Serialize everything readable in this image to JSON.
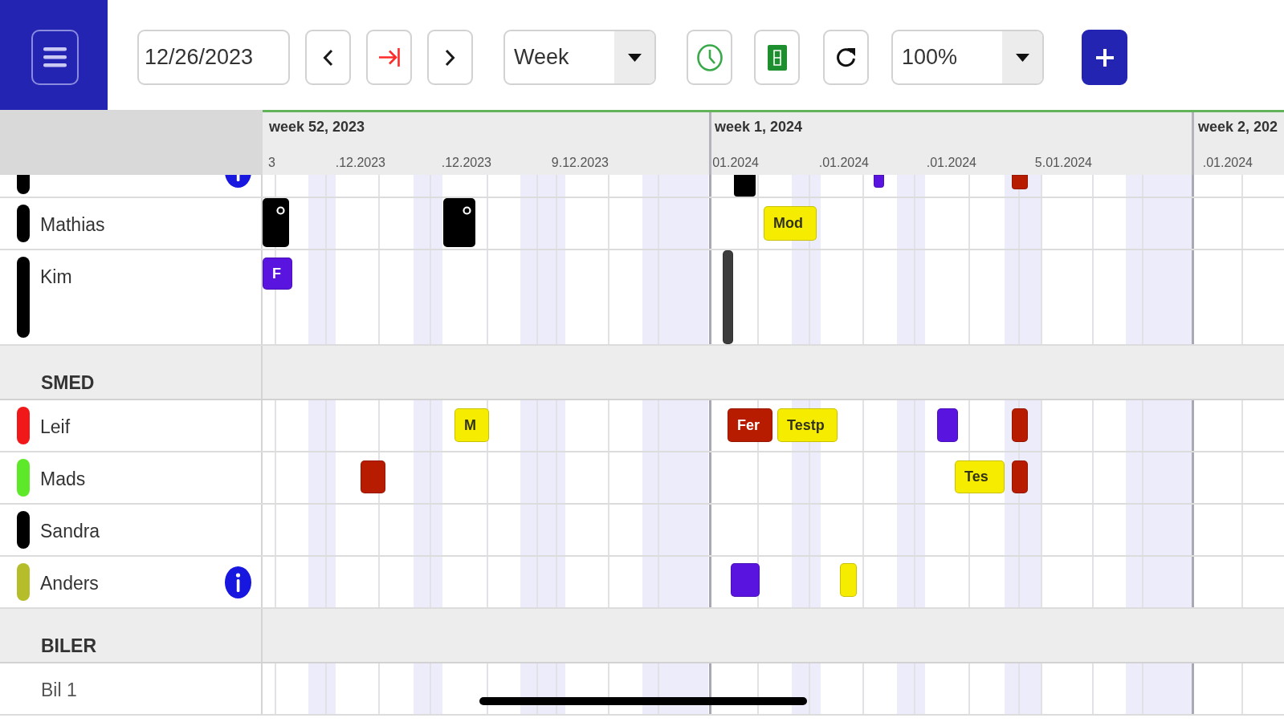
{
  "toolbar": {
    "date_field": {
      "value": "12/26/2023"
    },
    "view_select": {
      "value": "Week"
    },
    "zoom_select": {
      "value": "100%"
    }
  },
  "timeline_header": {
    "weeks": [
      "week 52, 2023",
      "week 1, 2024",
      "week 2, 202"
    ],
    "days": [
      "3",
      ".12.2023",
      ".12.2023",
      "9.12.2023",
      "01.2024",
      ".01.2024",
      ".01.2024",
      "5.01.2024",
      ".01.2024"
    ]
  },
  "rows": [
    {
      "kind": "clipped",
      "color": "#000000",
      "info": true,
      "events": [
        {
          "color": "#000000",
          "flag": false
        },
        {
          "color": "#5a14e0",
          "flag": false
        },
        {
          "color": "#b81c00",
          "flag": false
        }
      ]
    },
    {
      "kind": "person",
      "name": "Mathias",
      "color": "#000000",
      "info": false,
      "events": [
        {
          "color": "#000000",
          "flag": true
        },
        {
          "color": "#000000",
          "flag": true
        },
        {
          "label": "Mod",
          "color": "#f5ec00",
          "flag": false
        }
      ]
    },
    {
      "kind": "person",
      "name": "Kim",
      "color": "#000000",
      "info": false,
      "events": [
        {
          "label": "F",
          "color": "#5a14e0",
          "flag": false
        },
        {
          "color": "#3c3c3c",
          "flag": false
        }
      ]
    },
    {
      "kind": "group",
      "name": "SMED"
    },
    {
      "kind": "person",
      "name": "Leif",
      "color": "#f01818",
      "info": false,
      "events": [
        {
          "label": "M",
          "color": "#f5ec00",
          "flag": false
        },
        {
          "label": "Fer",
          "color": "#b81c00",
          "flag": false
        },
        {
          "label": "Testp",
          "color": "#f5ec00",
          "flag": false
        },
        {
          "color": "#5a14e0",
          "flag": false
        },
        {
          "color": "#b81c00",
          "flag": false
        }
      ]
    },
    {
      "kind": "person",
      "name": "Mads",
      "color": "#5ee82a",
      "info": false,
      "events": [
        {
          "color": "#b81c00",
          "flag": false
        },
        {
          "label": "Tes",
          "color": "#f5ec00",
          "flag": false
        },
        {
          "color": "#b81c00",
          "flag": false
        }
      ]
    },
    {
      "kind": "person",
      "name": "Sandra",
      "color": "#000000",
      "info": false
    },
    {
      "kind": "person",
      "name": "Anders",
      "color": "#b5be2a",
      "info": true,
      "events": [
        {
          "color": "#5a14e0",
          "flag": false
        },
        {
          "color": "#f5ec00",
          "flag": false
        }
      ]
    },
    {
      "kind": "group",
      "name": "BILER"
    },
    {
      "kind": "resource",
      "name": "Bil 1"
    }
  ]
}
